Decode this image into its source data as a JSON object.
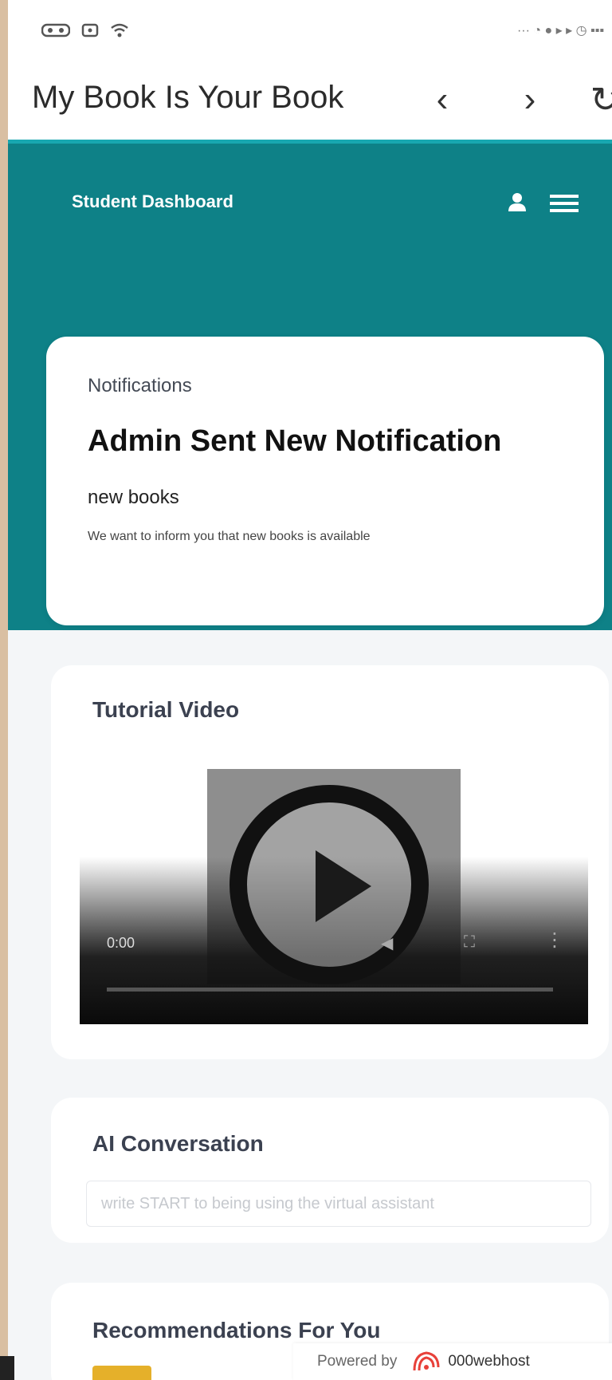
{
  "statusbar": {
    "left_icons": [
      "vr-icon",
      "sim-icon",
      "wifi-icon"
    ],
    "right_text": "··· ◔ ● ▸ ▸ ◷ ▪▪▪"
  },
  "browser": {
    "title": "My Book Is Your Book",
    "back_label": "‹",
    "forward_label": "›",
    "reload_label": "↻"
  },
  "header": {
    "title": "Student Dashboard"
  },
  "notifications": {
    "section_label": "Notifications",
    "heading": "Admin Sent New Notification",
    "subject": "new books",
    "body": "We want to inform you that new books is available"
  },
  "video": {
    "title": "Tutorial Video",
    "time": "0:00",
    "volume_label": "◀",
    "fullscreen_label": "⛶",
    "more_label": "⋮"
  },
  "ai": {
    "title": "AI Conversation",
    "placeholder": "write START to being using the virtual assistant"
  },
  "recommendations": {
    "title": "Recommendations For You"
  },
  "footer": {
    "powered_label": "Powered by",
    "brand": "000webhost"
  },
  "colors": {
    "teal": "#0e8187",
    "accent_line": "#18a7b0",
    "background": "#f4f6f8"
  }
}
